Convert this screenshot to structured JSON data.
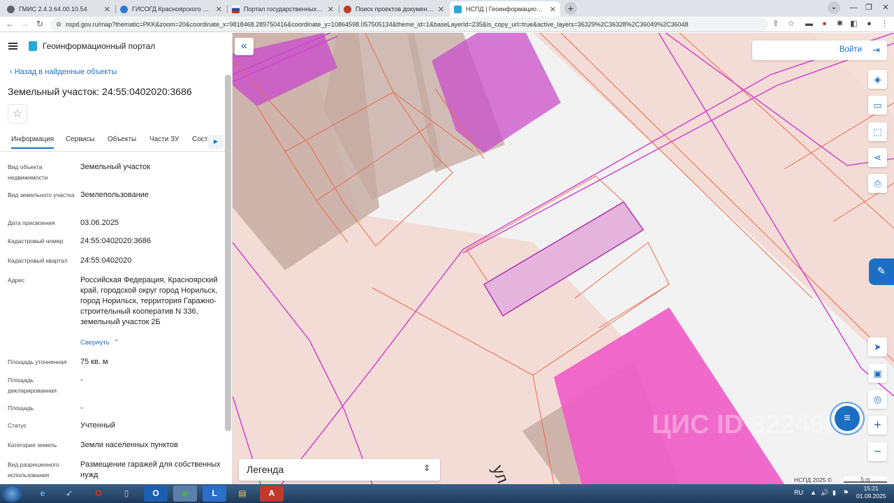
{
  "browser": {
    "tabs": [
      {
        "label": "ГМИС 2.4.3.64.00.10.54",
        "color": "#5f6368"
      },
      {
        "label": "ГИСОГД Красноярского края",
        "color": "#2e7bd1"
      },
      {
        "label": "Портал государственных услуг",
        "color": "#1a4fa0"
      },
      {
        "label": "Поиск проектов документов",
        "color": "#c0392b"
      },
      {
        "label": "НСПД | Геоинформационный п",
        "color": "#2aa7d9"
      }
    ],
    "url": "nspd.gov.ru/map?thematic=PKK&zoom=20&coordinate_x=9818468.289750416&coordinate_y=10864598.057505134&theme_id=1&baseLayerId=235&is_copy_url=true&active_layers=36329%2C36328%2C36049%2C36048"
  },
  "panel": {
    "portal_title": "Геоинформационный портал",
    "back_label": "Назад в найденные объекты",
    "parcel_title": "Земельный участок: 24:55:0402020:3686",
    "tabs": [
      "Информация",
      "Сервисы",
      "Объекты",
      "Части ЗУ",
      "Соста"
    ],
    "rows": [
      {
        "k": "Вид объекта недвижимости",
        "v": "Земельный участок"
      },
      {
        "k": "Вид земельного участка",
        "v": "Землепользование"
      },
      {
        "k": "Дата присвоения",
        "v": "03.06.2025"
      },
      {
        "k": "Кадастровый номер",
        "v": "24:55:0402020:3686"
      },
      {
        "k": "Кадастровый квартал",
        "v": "24:55:0402020"
      },
      {
        "k": "Адрес",
        "v": "Российская Федерация, Красноярский край, городской округ город Норильск, город Норильск, территория Гаражно-строительный кооператив N 336, земельный участок 2Б"
      },
      {
        "k": "Площадь уточненная",
        "v": "75 кв. м"
      },
      {
        "k": "Площадь декларированная",
        "v": "-"
      },
      {
        "k": "Площадь",
        "v": "-"
      },
      {
        "k": "Статус",
        "v": "Учтенный"
      },
      {
        "k": "Категория земель",
        "v": "Земли населенных пунктов"
      },
      {
        "k": "Вид разрешенного использования",
        "v": "Размещение гаражей для собственных нужд"
      }
    ],
    "collapse_label": "Свернуть"
  },
  "map": {
    "login_label": "Войти",
    "legend_label": "Легенда",
    "copyright": "НСПД 2025 ©",
    "scale": "5 m",
    "street_label": "ул",
    "watermark": "ЦИС ID 3224600"
  },
  "taskbar": {
    "lang": "RU",
    "time": "15:21",
    "date": "01.09.2025"
  }
}
